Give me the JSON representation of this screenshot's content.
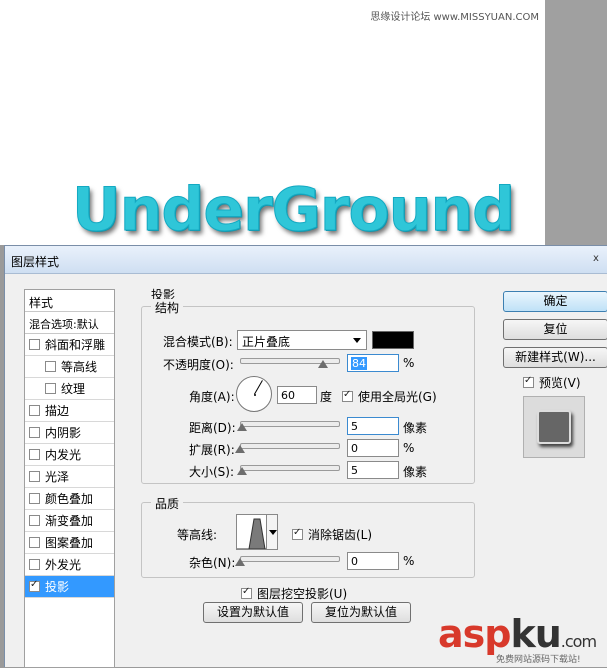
{
  "canvas": {
    "watermark_top": "思缘设计论坛 www.MISSYUAN.COM",
    "headline_text": "UnderGround",
    "headline_color": "#2fc6d8"
  },
  "dialog": {
    "title": "图层样式",
    "close_glyph": "x"
  },
  "style_list": {
    "header": "样式",
    "blend_options": "混合选项:默认",
    "items": [
      {
        "label": "斜面和浮雕",
        "checked": false
      },
      {
        "label": "等高线",
        "checked": false,
        "sub": true
      },
      {
        "label": "纹理",
        "checked": false,
        "sub": true
      },
      {
        "label": "描边",
        "checked": false
      },
      {
        "label": "内阴影",
        "checked": false
      },
      {
        "label": "内发光",
        "checked": false
      },
      {
        "label": "光泽",
        "checked": false
      },
      {
        "label": "颜色叠加",
        "checked": false
      },
      {
        "label": "渐变叠加",
        "checked": false
      },
      {
        "label": "图案叠加",
        "checked": false
      },
      {
        "label": "外发光",
        "checked": false
      },
      {
        "label": "投影",
        "checked": true,
        "selected": true
      }
    ]
  },
  "drop_shadow": {
    "section_title": "投影",
    "structure": {
      "legend": "结构",
      "blend_mode_label": "混合模式(B):",
      "blend_mode_value": "正片叠底",
      "shadow_color": "#000000",
      "opacity_label": "不透明度(O):",
      "opacity_value": "84",
      "opacity_unit": "%",
      "angle_label": "角度(A):",
      "angle_value": "60",
      "angle_unit": "度",
      "global_light_label": "使用全局光(G)",
      "global_light_checked": true,
      "distance_label": "距离(D):",
      "distance_value": "5",
      "distance_unit": "像素",
      "spread_label": "扩展(R):",
      "spread_value": "0",
      "spread_unit": "%",
      "size_label": "大小(S):",
      "size_value": "5",
      "size_unit": "像素"
    },
    "quality": {
      "legend": "品质",
      "contour_label": "等高线:",
      "anti_alias_label": "消除锯齿(L)",
      "anti_alias_checked": true,
      "noise_label": "杂色(N):",
      "noise_value": "0",
      "noise_unit": "%"
    },
    "knockout_label": "图层挖空投影(U)",
    "knockout_checked": true,
    "make_default_label": "设置为默认值",
    "reset_default_label": "复位为默认值"
  },
  "buttons": {
    "ok": "确定",
    "reset": "复位",
    "new_style": "新建样式(W)...",
    "preview_label": "预览(V)",
    "preview_checked": true
  },
  "watermark_bottom": {
    "asp": "asp",
    "ku": "ku",
    "com": ".com",
    "sub": "免费网站源码下载站!"
  }
}
